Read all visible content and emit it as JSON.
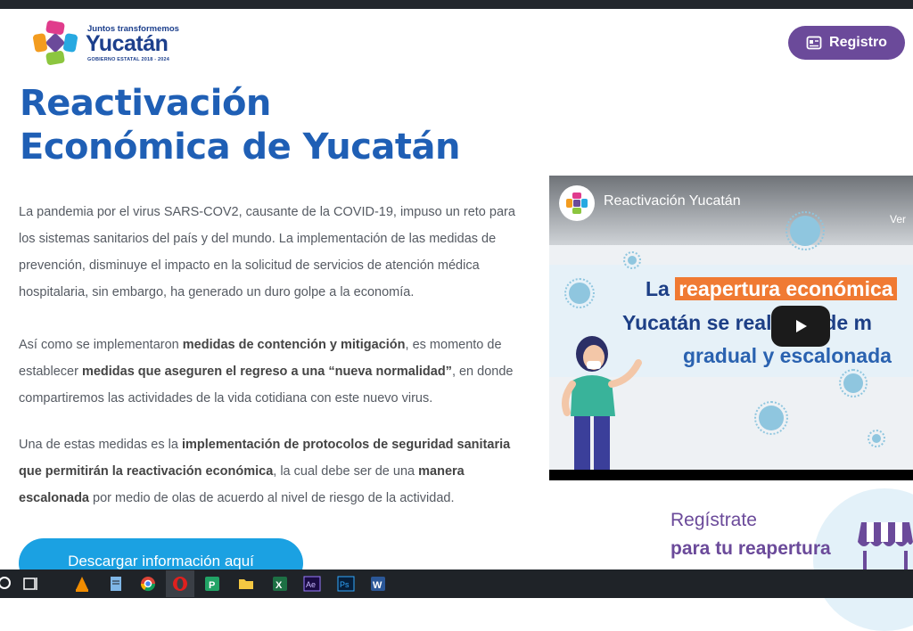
{
  "header": {
    "logo": {
      "tagline": "Juntos transformemos",
      "name": "Yucatán",
      "subtitle": "GOBIERNO ESTATAL 2018 - 2024"
    },
    "registro_label": "Registro",
    "registro_icon": "id-card-icon"
  },
  "main": {
    "title_line1": "Reactivación",
    "title_line2": "Económica de Yucatán",
    "paragraphs": {
      "p1": {
        "text": "La pandemia por el virus SARS-COV2, causante de la COVID-19, impuso un reto para los sistemas sanitarios del país y del mundo. La implementación de las medidas de prevención, disminuye el impacto en la solicitud de servicios de atención médica hospitalaria, sin embargo, ha generado un duro golpe a la economía."
      },
      "p2": {
        "a": "Así como se implementaron ",
        "b": "medidas de contención y mitigación",
        "c": ", es momento de establecer ",
        "d": "medidas que aseguren el regreso a una “nueva normalidad”",
        "e": ", en donde compartiremos las actividades de la vida cotidiana con este nuevo virus."
      },
      "p3": {
        "a": "Una de estas medidas es la ",
        "b": "implementación de protocolos de seguridad sanitaria que permitirán la reactivación económica",
        "c": ", la cual debe ser de una ",
        "d": "manera escalonada",
        "e": " por medio de olas de acuerdo al nivel de riesgo de la actividad."
      }
    },
    "download_label": "Descargar información aquí"
  },
  "video": {
    "title": "Reactivación Yucatán",
    "ver_label": "Ver",
    "banner": {
      "line1_prefix": "La ",
      "line1_highlight": "reapertura económica",
      "line2": "Yucatán se realizará de m",
      "line3": "gradual y escalonada"
    },
    "play_icon": "play-icon"
  },
  "register_promo": {
    "line1": "Regístrate",
    "line2": "para tu reapertura",
    "icon": "store-awning-icon"
  },
  "taskbar": {
    "items": [
      "search-icon",
      "task-view-icon",
      "vlc-icon",
      "notepad-icon",
      "chrome-icon",
      "opera-icon",
      "publisher-icon",
      "file-explorer-icon",
      "excel-icon",
      "after-effects-icon",
      "photoshop-icon",
      "word-icon"
    ]
  },
  "colors": {
    "brand_purple": "#6b4a9a",
    "title_blue": "#1f5fb5",
    "download_blue": "#1ba1e2",
    "banner_orange": "#f07a33"
  }
}
